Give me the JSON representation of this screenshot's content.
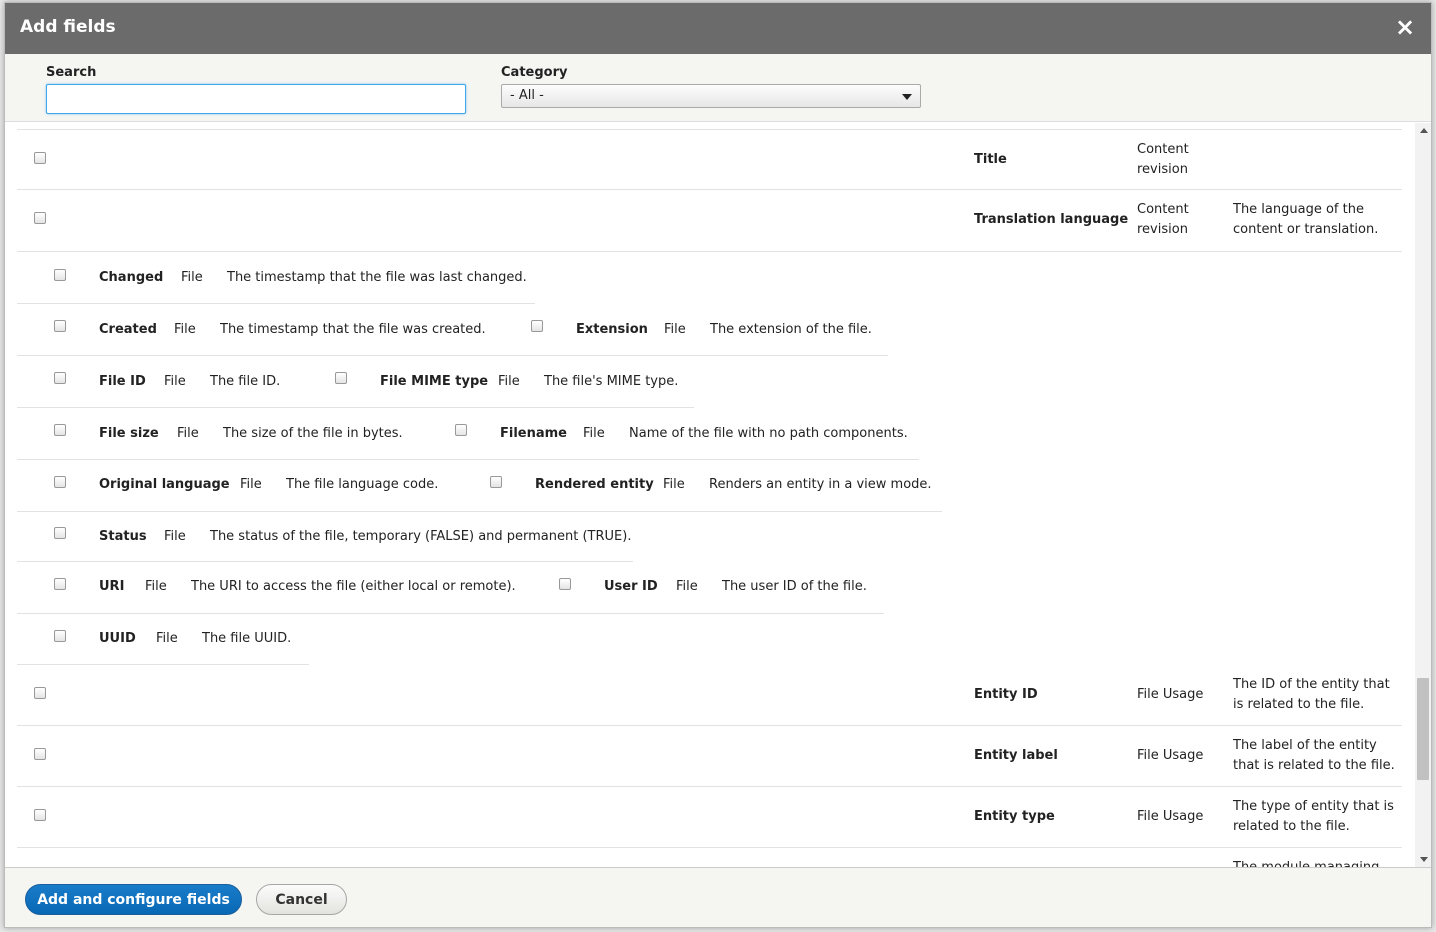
{
  "dialog": {
    "title": "Add fields",
    "close_label": "×"
  },
  "filters": {
    "search_label": "Search",
    "search_value": "",
    "category_label": "Category",
    "category_value": "- All -"
  },
  "table_rows": [
    {
      "name": "Title",
      "category": "Content revision",
      "description": ""
    },
    {
      "name": "Translation language",
      "category": "Content revision",
      "description": "The language of the content or translation."
    }
  ],
  "file_fields": [
    {
      "name": "Changed",
      "category": "File",
      "description": "The timestamp that the file was last changed."
    },
    {
      "name": "Created",
      "category": "File",
      "description": "The timestamp that the file was created."
    },
    {
      "name": "Extension",
      "category": "File",
      "description": "The extension of the file."
    },
    {
      "name": "File ID",
      "category": "File",
      "description": "The file ID."
    },
    {
      "name": "File MIME type",
      "category": "File",
      "description": "The file's MIME type."
    },
    {
      "name": "File size",
      "category": "File",
      "description": "The size of the file in bytes."
    },
    {
      "name": "Filename",
      "category": "File",
      "description": "Name of the file with no path components."
    },
    {
      "name": "Original language",
      "category": "File",
      "description": "The file language code."
    },
    {
      "name": "Rendered entity",
      "category": "File",
      "description": "Renders an entity in a view mode."
    },
    {
      "name": "Status",
      "category": "File",
      "description": "The status of the file, temporary (FALSE) and permanent (TRUE)."
    },
    {
      "name": "URI",
      "category": "File",
      "description": "The URI to access the file (either local or remote)."
    },
    {
      "name": "User ID",
      "category": "File",
      "description": "The user ID of the file."
    },
    {
      "name": "UUID",
      "category": "File",
      "description": "The file UUID."
    }
  ],
  "usage_rows": [
    {
      "name": "Entity ID",
      "category": "File Usage",
      "description": "The ID of the entity that is related to the file."
    },
    {
      "name": "Entity label",
      "category": "File Usage",
      "description": "The label of the entity that is related to the file."
    },
    {
      "name": "Entity type",
      "category": "File Usage",
      "description": "The type of entity that is related to the file."
    },
    {
      "name": "",
      "category": "",
      "description": "The module managing"
    }
  ],
  "footer": {
    "primary_label": "Add and configure fields",
    "cancel_label": "Cancel"
  },
  "colors": {
    "titlebar": "#6b6b6b",
    "primary_button": "#0868b5",
    "focus_border": "#40a8e8"
  }
}
